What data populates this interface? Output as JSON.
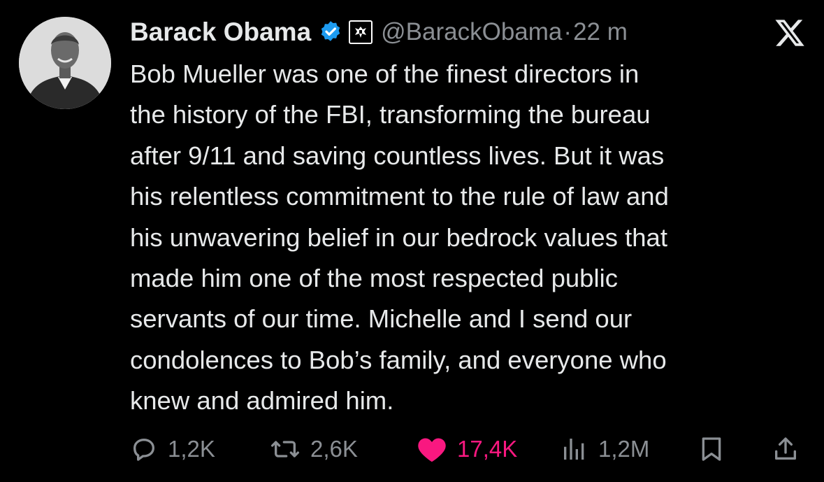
{
  "author": {
    "name": "Barack Obama",
    "handle": "@BarackObama",
    "separator": "·",
    "time": "22 m"
  },
  "icons": {
    "verified": "verified-badge-icon",
    "affiliation": "government-seal-icon",
    "brand": "x-logo-icon"
  },
  "colors": {
    "background": "#000000",
    "text": "#e7e9ea",
    "muted": "#8b8f94",
    "verified": "#1d9bf0",
    "like": "#f91880"
  },
  "tweet": {
    "lines": [
      "Bob Mueller was one of the finest directors in",
      "the history of the FBI, transforming the bureau",
      "after 9/11 and saving countless lives. But it was",
      "his relentless commitment to the rule of law and",
      "his unwavering belief in our bedrock values that",
      "made him one of the most respected public",
      "servants of our time. Michelle and I send our",
      "condolences to Bob’s family, and everyone who",
      "knew and admired him."
    ]
  },
  "actions": {
    "replies": "1,2K",
    "reposts": "2,6K",
    "likes": "17,4K",
    "views": "1,2M"
  }
}
